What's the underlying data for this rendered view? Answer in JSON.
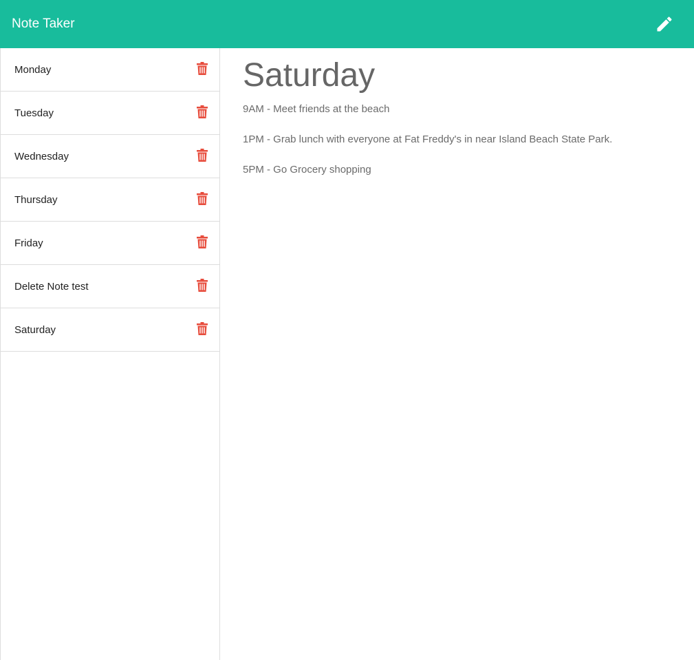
{
  "app": {
    "title": "Note Taker"
  },
  "colors": {
    "navbar": "#18bc9c",
    "delete_icon": "#e74c3c",
    "text_muted": "#666666"
  },
  "icons": {
    "new_note": "pencil-icon",
    "delete": "trash-icon"
  },
  "sidebar": {
    "notes": [
      {
        "title": "Monday"
      },
      {
        "title": "Tuesday"
      },
      {
        "title": "Wednesday"
      },
      {
        "title": "Thursday"
      },
      {
        "title": "Friday"
      },
      {
        "title": "Delete Note test"
      },
      {
        "title": "Saturday"
      }
    ]
  },
  "active_note": {
    "title": "Saturday",
    "lines": [
      "9AM - Meet friends at the beach",
      "1PM - Grab lunch with everyone at Fat Freddy's in near Island Beach State Park.",
      "5PM - Go Grocery shopping"
    ]
  }
}
